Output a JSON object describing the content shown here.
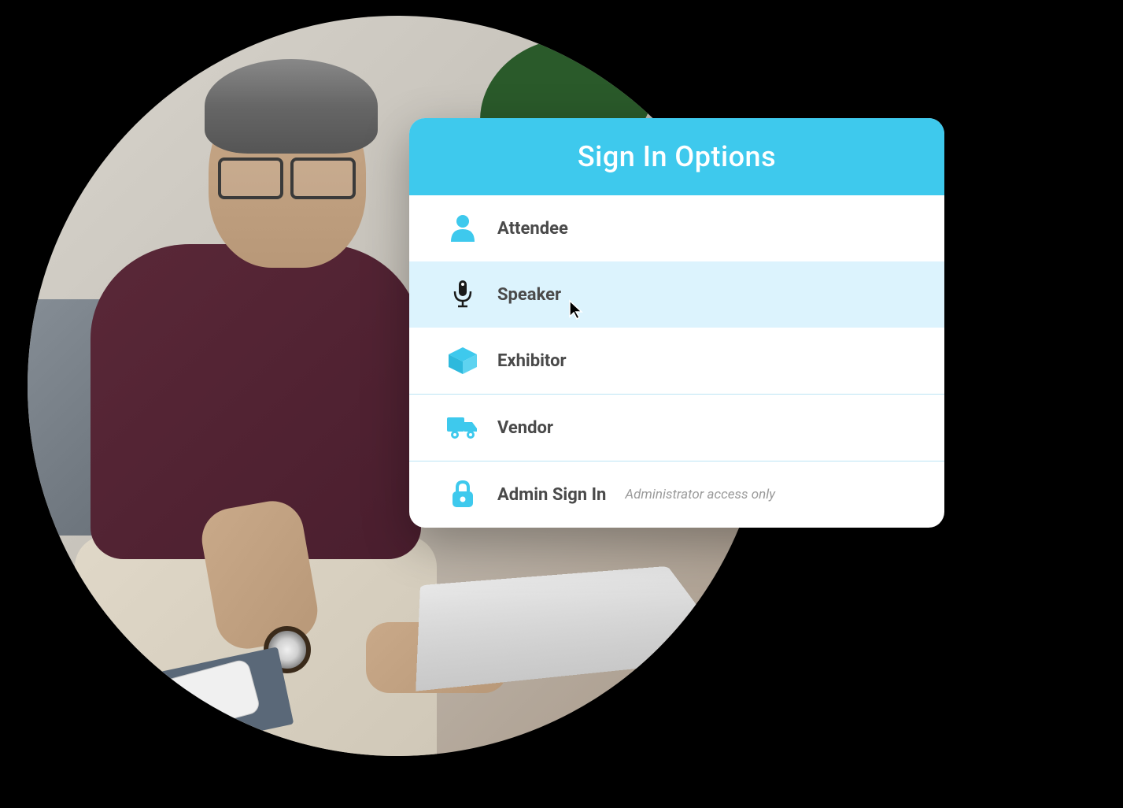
{
  "card": {
    "title": "Sign In Options",
    "options": [
      {
        "label": "Attendee",
        "icon": "person-icon",
        "caption": null
      },
      {
        "label": "Speaker",
        "icon": "microphone-icon",
        "caption": null,
        "highlighted": true
      },
      {
        "label": "Exhibitor",
        "icon": "box-icon",
        "caption": null
      },
      {
        "label": "Vendor",
        "icon": "truck-icon",
        "caption": null
      },
      {
        "label": "Admin Sign In",
        "icon": "lock-icon",
        "caption": "Administrator access only"
      }
    ]
  },
  "colors": {
    "accent": "#3ec9ed",
    "highlight": "#dcf3fd",
    "text": "#4a4a4a",
    "caption": "#9a9a9a"
  }
}
